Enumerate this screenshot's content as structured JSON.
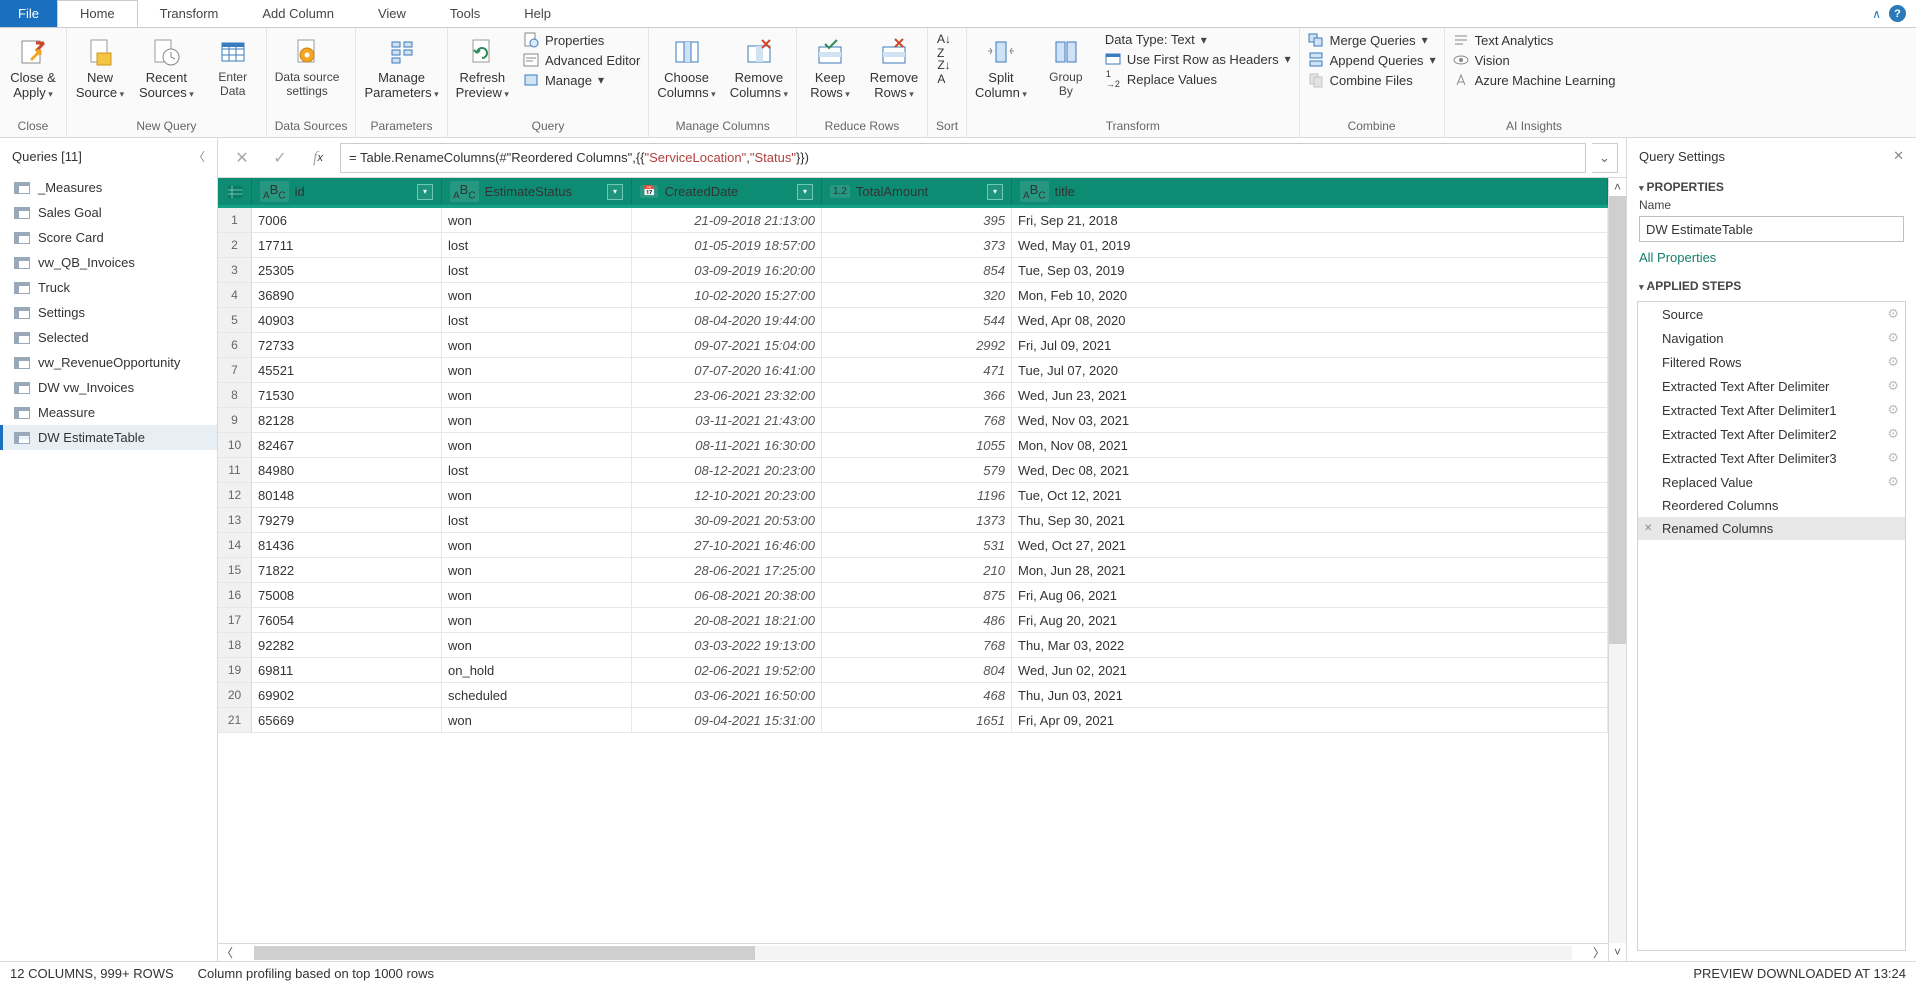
{
  "menu": {
    "file": "File",
    "tabs": [
      "Home",
      "Transform",
      "Add Column",
      "View",
      "Tools",
      "Help"
    ],
    "active": "Home"
  },
  "ribbon": {
    "close": {
      "closeApply": "Close &\nApply",
      "group": "Close"
    },
    "newQuery": {
      "newSource": "New\nSource",
      "recent": "Recent\nSources",
      "enterData": "Enter\nData",
      "group": "New Query"
    },
    "dataSources": {
      "btn": "Data source\nsettings",
      "group": "Data Sources"
    },
    "parameters": {
      "btn": "Manage\nParameters",
      "group": "Parameters"
    },
    "query": {
      "refresh": "Refresh\nPreview",
      "properties": "Properties",
      "advEditor": "Advanced Editor",
      "manage": "Manage",
      "group": "Query"
    },
    "manageCols": {
      "choose": "Choose\nColumns",
      "remove": "Remove\nColumns",
      "group": "Manage Columns"
    },
    "reduce": {
      "keep": "Keep\nRows",
      "remove": "Remove\nRows",
      "group": "Reduce Rows"
    },
    "sort": {
      "group": "Sort"
    },
    "transform": {
      "split": "Split\nColumn",
      "groupBy": "Group\nBy",
      "dataType": "Data Type: Text",
      "firstRow": "Use First Row as Headers",
      "replace": "Replace Values",
      "group": "Transform"
    },
    "combine": {
      "merge": "Merge Queries",
      "append": "Append Queries",
      "combineFiles": "Combine Files",
      "group": "Combine"
    },
    "ai": {
      "text": "Text Analytics",
      "vision": "Vision",
      "aml": "Azure Machine Learning",
      "group": "AI Insights"
    }
  },
  "queriesPane": {
    "title": "Queries [11]",
    "items": [
      "_Measures",
      "Sales Goal",
      "Score Card",
      "vw_QB_Invoices",
      "Truck",
      "Settings",
      "Selected",
      "vw_RevenueOpportunity",
      "DW vw_Invoices",
      "Meassure",
      "DW EstimateTable"
    ],
    "selected": "DW EstimateTable"
  },
  "formula": {
    "prefix": "= Table.RenameColumns(#\"Reordered Columns\",{{",
    "s1": "\"ServiceLocation\"",
    "mid": ", ",
    "s2": "\"Status\"",
    "suffix": "}})"
  },
  "columns": [
    "id",
    "EstimateStatus",
    "CreatedDate",
    "TotalAmount",
    "title"
  ],
  "colTypes": [
    "ABC",
    "ABC",
    "date",
    "1.2",
    "ABC"
  ],
  "rows": [
    {
      "n": 1,
      "id": "7006",
      "status": "won",
      "date": "21-09-2018 21:13:00",
      "amt": "395",
      "title": "Fri, Sep 21, 2018"
    },
    {
      "n": 2,
      "id": "17711",
      "status": "lost",
      "date": "01-05-2019 18:57:00",
      "amt": "373",
      "title": "Wed, May 01, 2019"
    },
    {
      "n": 3,
      "id": "25305",
      "status": "lost",
      "date": "03-09-2019 16:20:00",
      "amt": "854",
      "title": "Tue, Sep 03, 2019"
    },
    {
      "n": 4,
      "id": "36890",
      "status": "won",
      "date": "10-02-2020 15:27:00",
      "amt": "320",
      "title": "Mon, Feb 10, 2020"
    },
    {
      "n": 5,
      "id": "40903",
      "status": "lost",
      "date": "08-04-2020 19:44:00",
      "amt": "544",
      "title": "Wed, Apr 08, 2020"
    },
    {
      "n": 6,
      "id": "72733",
      "status": "won",
      "date": "09-07-2021 15:04:00",
      "amt": "2992",
      "title": "Fri, Jul 09, 2021"
    },
    {
      "n": 7,
      "id": "45521",
      "status": "won",
      "date": "07-07-2020 16:41:00",
      "amt": "471",
      "title": "Tue, Jul 07, 2020"
    },
    {
      "n": 8,
      "id": "71530",
      "status": "won",
      "date": "23-06-2021 23:32:00",
      "amt": "366",
      "title": "Wed, Jun 23, 2021"
    },
    {
      "n": 9,
      "id": "82128",
      "status": "won",
      "date": "03-11-2021 21:43:00",
      "amt": "768",
      "title": "Wed, Nov 03, 2021"
    },
    {
      "n": 10,
      "id": "82467",
      "status": "won",
      "date": "08-11-2021 16:30:00",
      "amt": "1055",
      "title": "Mon, Nov 08, 2021"
    },
    {
      "n": 11,
      "id": "84980",
      "status": "lost",
      "date": "08-12-2021 20:23:00",
      "amt": "579",
      "title": "Wed, Dec 08, 2021"
    },
    {
      "n": 12,
      "id": "80148",
      "status": "won",
      "date": "12-10-2021 20:23:00",
      "amt": "1196",
      "title": "Tue, Oct 12, 2021"
    },
    {
      "n": 13,
      "id": "79279",
      "status": "lost",
      "date": "30-09-2021 20:53:00",
      "amt": "1373",
      "title": "Thu, Sep 30, 2021"
    },
    {
      "n": 14,
      "id": "81436",
      "status": "won",
      "date": "27-10-2021 16:46:00",
      "amt": "531",
      "title": "Wed, Oct 27, 2021"
    },
    {
      "n": 15,
      "id": "71822",
      "status": "won",
      "date": "28-06-2021 17:25:00",
      "amt": "210",
      "title": "Mon, Jun 28, 2021"
    },
    {
      "n": 16,
      "id": "75008",
      "status": "won",
      "date": "06-08-2021 20:38:00",
      "amt": "875",
      "title": "Fri, Aug 06, 2021"
    },
    {
      "n": 17,
      "id": "76054",
      "status": "won",
      "date": "20-08-2021 18:21:00",
      "amt": "486",
      "title": "Fri, Aug 20, 2021"
    },
    {
      "n": 18,
      "id": "92282",
      "status": "won",
      "date": "03-03-2022 19:13:00",
      "amt": "768",
      "title": "Thu, Mar 03, 2022"
    },
    {
      "n": 19,
      "id": "69811",
      "status": "on_hold",
      "date": "02-06-2021 19:52:00",
      "amt": "804",
      "title": "Wed, Jun 02, 2021"
    },
    {
      "n": 20,
      "id": "69902",
      "status": "scheduled",
      "date": "03-06-2021 16:50:00",
      "amt": "468",
      "title": "Thu, Jun 03, 2021"
    },
    {
      "n": 21,
      "id": "65669",
      "status": "won",
      "date": "09-04-2021 15:31:00",
      "amt": "1651",
      "title": "Fri, Apr 09, 2021"
    }
  ],
  "settings": {
    "title": "Query Settings",
    "propsHdr": "PROPERTIES",
    "nameLbl": "Name",
    "name": "DW EstimateTable",
    "allProps": "All Properties",
    "stepsHdr": "APPLIED STEPS",
    "steps": [
      {
        "t": "Source",
        "g": true
      },
      {
        "t": "Navigation",
        "g": true
      },
      {
        "t": "Filtered Rows",
        "g": true
      },
      {
        "t": "Extracted Text After Delimiter",
        "g": true
      },
      {
        "t": "Extracted Text After Delimiter1",
        "g": true
      },
      {
        "t": "Extracted Text After Delimiter2",
        "g": true
      },
      {
        "t": "Extracted Text After Delimiter3",
        "g": true
      },
      {
        "t": "Replaced Value",
        "g": true
      },
      {
        "t": "Reordered Columns",
        "g": false
      },
      {
        "t": "Renamed Columns",
        "g": false,
        "sel": true
      }
    ]
  },
  "status": {
    "left": "12 COLUMNS, 999+ ROWS",
    "profile": "Column profiling based on top 1000 rows",
    "right": "PREVIEW DOWNLOADED AT 13:24"
  }
}
